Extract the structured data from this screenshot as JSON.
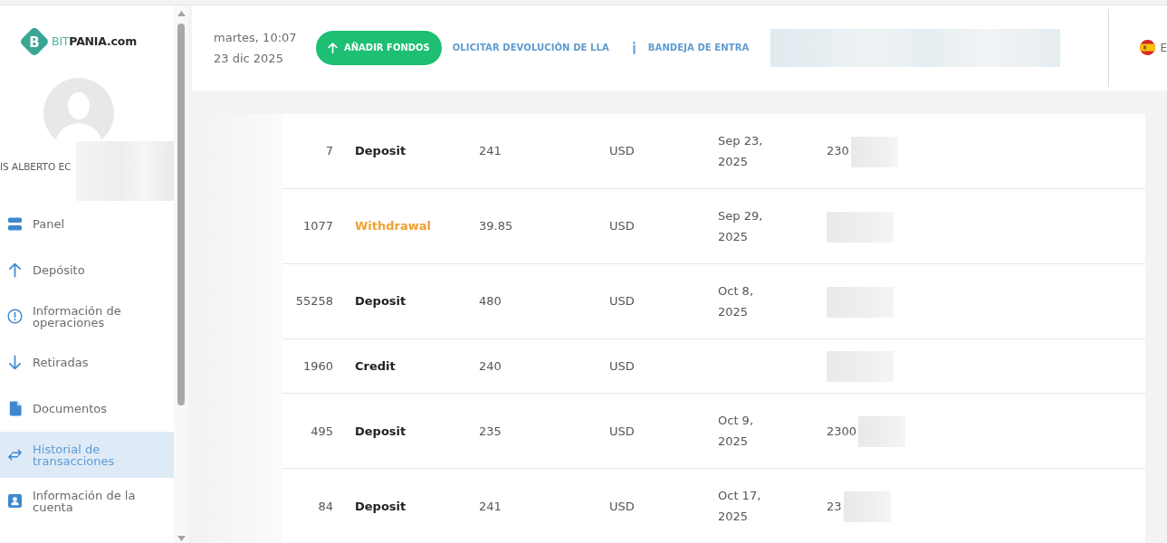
{
  "sidebar": {
    "logo": {
      "mark": "B",
      "text": "BIT**PANIA.com**"
    },
    "user": {
      "name": "IS ALBERTO EC",
      "redacted": true
    },
    "nav": [
      {
        "label": "Panel",
        "selected": false
      },
      {
        "label": "Depósito",
        "selected": false
      },
      {
        "label": "Información de operaciones",
        "selected": false
      },
      {
        "label": "Retiradas",
        "selected": false
      },
      {
        "label": "Documentos",
        "selected": false
      },
      {
        "label": "Historial de transacciones",
        "selected": true
      },
      {
        "label": "Información de la cuenta",
        "selected": false
      }
    ]
  },
  "header": {
    "day_time": "martes, 10:07",
    "date": "23 dic 2025",
    "add_funds_button": "AÑADIR FONDOS",
    "links": [
      {
        "label": "OLICITAR DEVOLUCIÓN DE LLA"
      },
      {
        "label": "BANDEJA DE ENTRA"
      }
    ],
    "redacted": true,
    "language": "E"
  },
  "table": {
    "redacted": true,
    "rows": [
      {
        "column_1": "7",
        "column_2": {
          "text": "Deposit",
          "color": "#222222"
        },
        "column_3": "241",
        "column_4": "USD",
        "column_5": "Sep 23, 2025",
        "column_6": "230",
        "redacted": true
      },
      {
        "column_1": "1077",
        "column_2": {
          "text": "Withdrawal",
          "color": "#f0a030"
        },
        "column_3": "39.85",
        "column_4": "USD",
        "column_5": "Sep 29, 2025",
        "redacted": true
      },
      {
        "column_1": "55258",
        "column_2": {
          "text": "Deposit",
          "color": "#222222"
        },
        "column_3": "480",
        "column_4": "USD",
        "column_5": "Oct 8, 2025",
        "redacted": true
      },
      {
        "column_1": "1960",
        "column_2": {
          "text": "Credit",
          "color": "#222222"
        },
        "column_3": "240",
        "column_4": "USD",
        "redacted": true
      },
      {
        "column_1": "495",
        "column_2": {
          "text": "Deposit",
          "color": "#222222"
        },
        "column_3": "235",
        "column_4": "USD",
        "column_5": "Oct 9, 2025",
        "column_6": "2300",
        "redacted": true
      },
      {
        "column_1": "84",
        "column_2": {
          "text": "Deposit",
          "color": "#222222"
        },
        "column_3": "241",
        "column_4": "USD",
        "column_5": "Oct 17, 2025",
        "column_6": "23",
        "redacted": true
      }
    ]
  }
}
